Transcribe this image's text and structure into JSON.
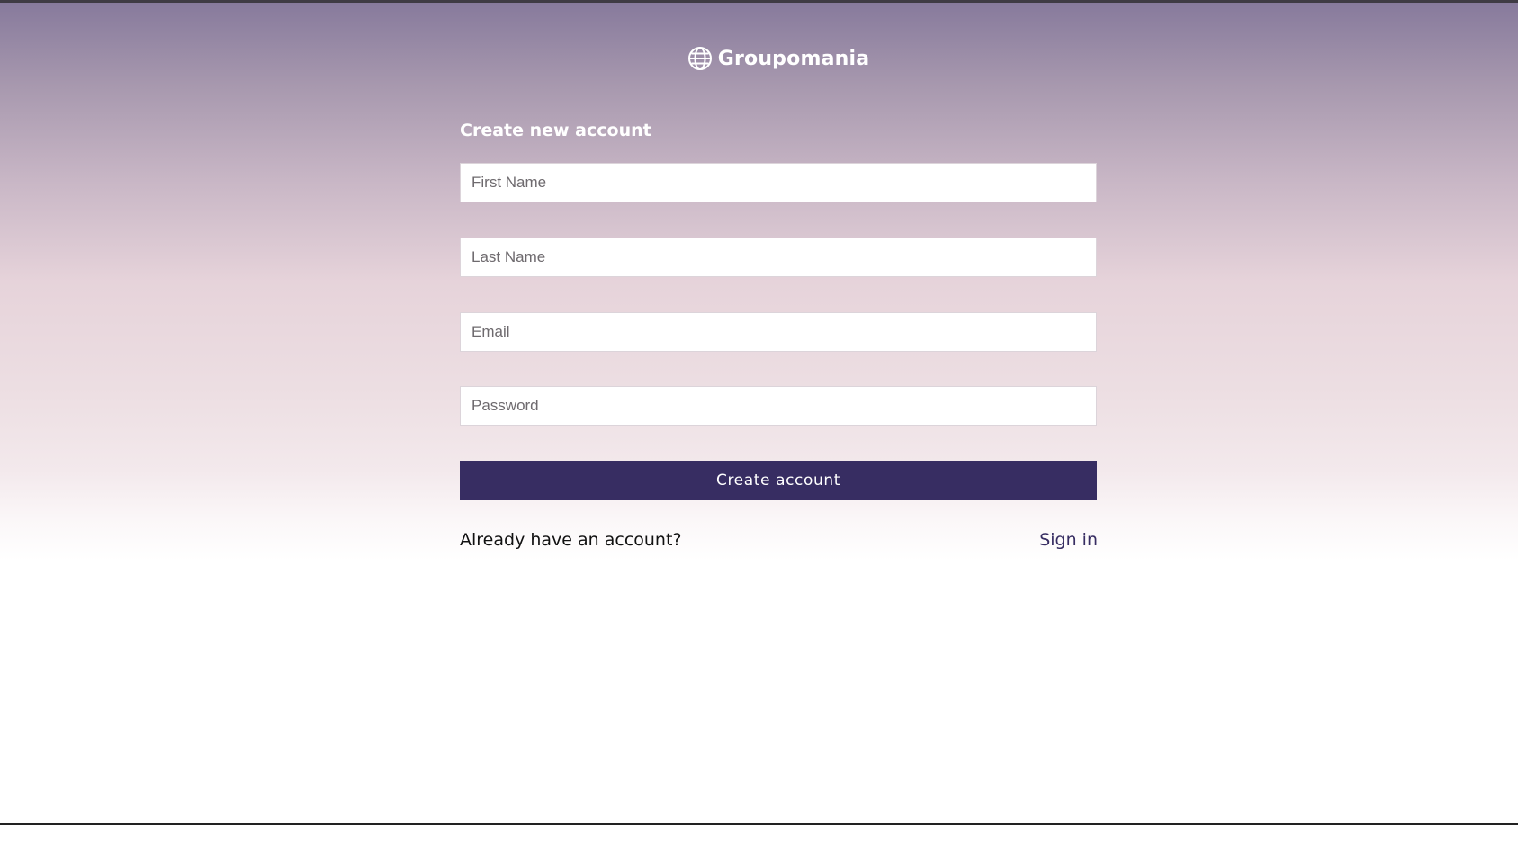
{
  "brand": {
    "name": "Groupomania",
    "icon": "globe-icon"
  },
  "form": {
    "title": "Create new account",
    "fields": {
      "first_name": {
        "placeholder": "First Name",
        "value": ""
      },
      "last_name": {
        "placeholder": "Last Name",
        "value": ""
      },
      "email": {
        "placeholder": "Email",
        "value": ""
      },
      "password": {
        "placeholder": "Password",
        "value": ""
      }
    },
    "submit_label": "Create account"
  },
  "footer": {
    "prompt": "Already have an account?",
    "signin_label": "Sign in"
  },
  "colors": {
    "primary": "#372d62",
    "gradient_top": "#877a9c",
    "gradient_mid": "#e6d3da",
    "background": "#ffffff"
  }
}
